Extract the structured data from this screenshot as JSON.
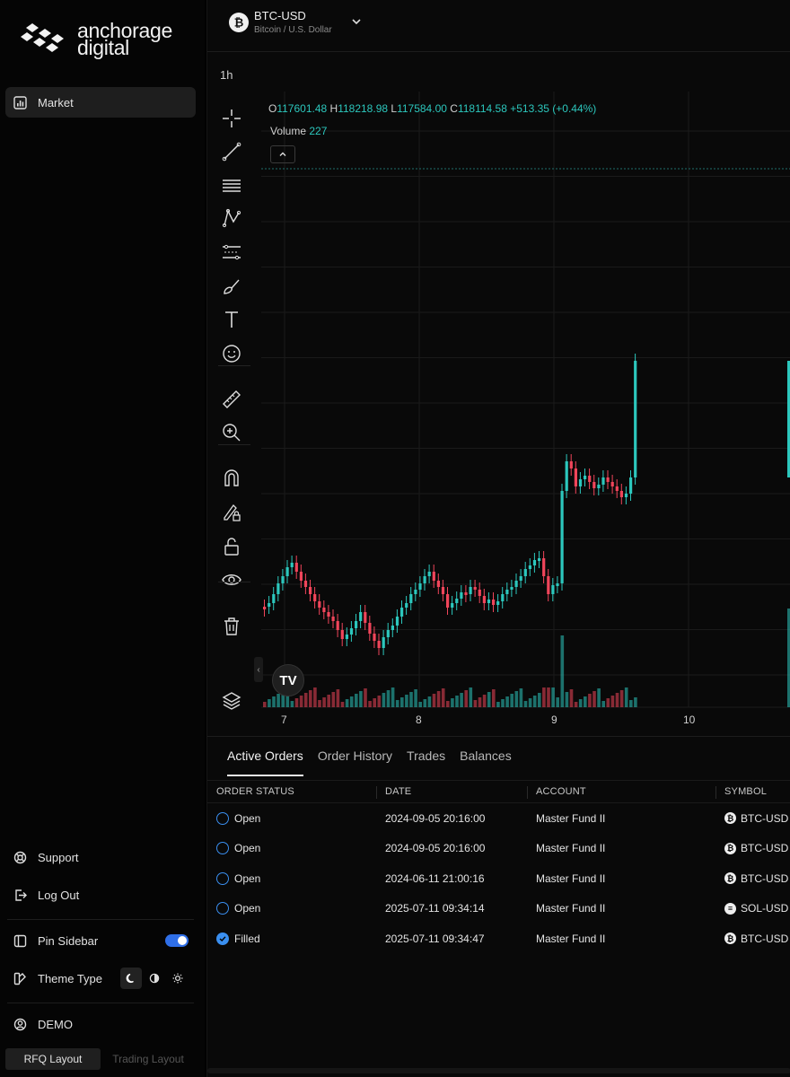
{
  "brand": {
    "line1": "anchorage",
    "line2": "digital"
  },
  "sidebar": {
    "nav": [
      {
        "label": "Market",
        "icon": "bar-chart-icon",
        "active": true
      }
    ],
    "bottom": {
      "support": "Support",
      "logout": "Log Out",
      "pin_sidebar": "Pin Sidebar",
      "pin_enabled": true,
      "theme_type": "Theme Type",
      "theme_selected": "dark",
      "user": "DEMO",
      "layouts": [
        "RFQ Layout",
        "Trading Layout"
      ],
      "layout_selected": "RFQ Layout"
    }
  },
  "instrument": {
    "symbol": "BTC-USD",
    "description": "Bitcoin / U.S. Dollar",
    "icon": "bitcoin-icon"
  },
  "chart": {
    "interval": "1h",
    "ohlc": {
      "o_label": "O",
      "o": "117601.48",
      "h_label": "H",
      "h": "118218.98",
      "l_label": "L",
      "l": "117584.00",
      "c_label": "C",
      "c": "118114.58",
      "change": "+513.35 (+0.44%)"
    },
    "volume_label": "Volume",
    "volume_value": "227",
    "tv_mark": "TV",
    "colors": {
      "up": "#2cc7bd",
      "down": "#f0455a",
      "grid": "#1a1a1a"
    }
  },
  "chart_data": {
    "type": "candlestick",
    "x_ticks": [
      "7",
      "8",
      "9",
      "10"
    ],
    "series": [
      {
        "name": "Volume"
      }
    ]
  },
  "orders": {
    "tabs": [
      "Active Orders",
      "Order History",
      "Trades",
      "Balances"
    ],
    "selected_tab": "Active Orders",
    "columns": [
      "ORDER STATUS",
      "DATE",
      "ACCOUNT",
      "SYMBOL"
    ],
    "rows": [
      {
        "status": "Open",
        "date": "2024-09-05 20:16:00",
        "account": "Master Fund II",
        "symbol": "BTC-USD",
        "coin": "bitcoin"
      },
      {
        "status": "Open",
        "date": "2024-09-05 20:16:00",
        "account": "Master Fund II",
        "symbol": "BTC-USD",
        "coin": "bitcoin"
      },
      {
        "status": "Open",
        "date": "2024-06-11 21:00:16",
        "account": "Master Fund II",
        "symbol": "BTC-USD",
        "coin": "bitcoin"
      },
      {
        "status": "Open",
        "date": "2025-07-11 09:34:14",
        "account": "Master Fund II",
        "symbol": "SOL-USD",
        "coin": "solana"
      },
      {
        "status": "Filled",
        "date": "2025-07-11 09:34:47",
        "account": "Master Fund II",
        "symbol": "BTC-USD",
        "coin": "bitcoin"
      }
    ]
  }
}
